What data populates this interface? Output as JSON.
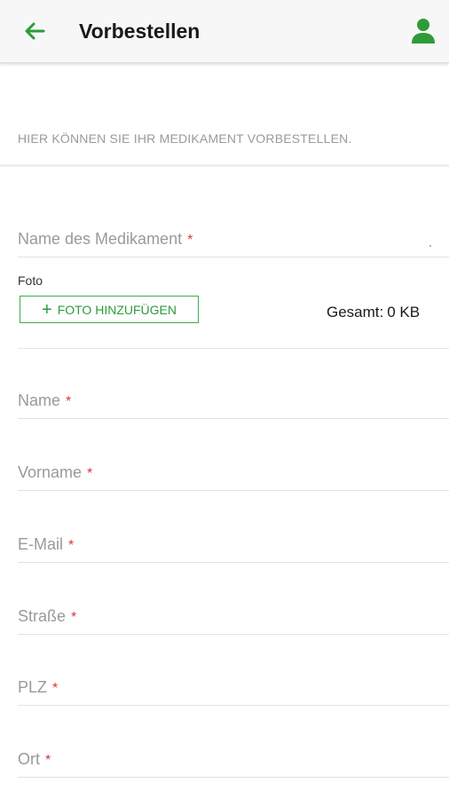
{
  "appbar": {
    "title": "Vorbestellen",
    "back_icon": "arrow-left-icon",
    "profile_icon": "person-icon",
    "accent_color": "#2e9a3a"
  },
  "intro_text": "HIER KÖNNEN SIE IHR MEDIKAMENT VORBESTELLEN.",
  "medication_field": {
    "label": "Name des Medikament",
    "required_mark": "*"
  },
  "photo": {
    "label": "Foto",
    "button_label": "FOTO HINZUFÜGEN",
    "button_icon": "plus-icon",
    "total_label": "Gesamt:",
    "total_value": "0 KB"
  },
  "fields": [
    {
      "label": "Name",
      "required_mark": "*"
    },
    {
      "label": "Vorname",
      "required_mark": "*"
    },
    {
      "label": "E-Mail",
      "required_mark": "*"
    },
    {
      "label": "Straße",
      "required_mark": "*"
    },
    {
      "label": "PLZ",
      "required_mark": "*"
    },
    {
      "label": "Ort",
      "required_mark": "*"
    }
  ],
  "required_color": "#d9363e"
}
